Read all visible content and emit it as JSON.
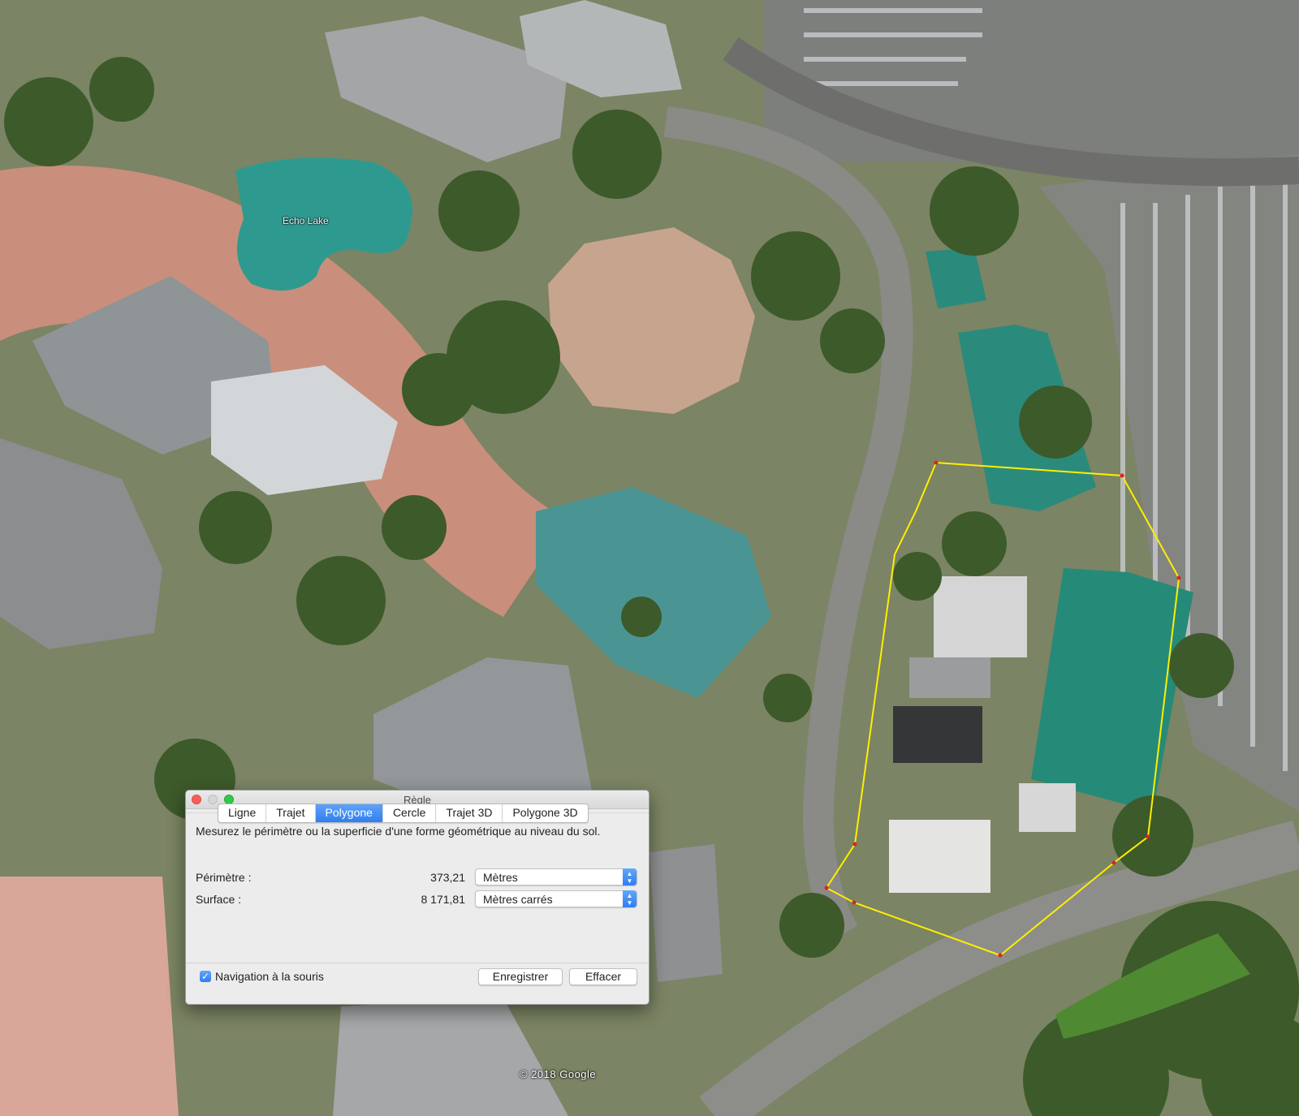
{
  "map": {
    "place_label": "Echo Lake",
    "copyright": "© 2018 Google",
    "measurement_line_color": "#ffee00",
    "vertex_color": "#e02020"
  },
  "dialog": {
    "title": "Règle",
    "tabs": [
      {
        "label": "Ligne",
        "active": false
      },
      {
        "label": "Trajet",
        "active": false
      },
      {
        "label": "Polygone",
        "active": true
      },
      {
        "label": "Cercle",
        "active": false
      },
      {
        "label": "Trajet 3D",
        "active": false
      },
      {
        "label": "Polygone 3D",
        "active": false
      }
    ],
    "description": "Mesurez le périmètre ou la superficie d'une forme géométrique au niveau du sol.",
    "perimeter": {
      "label": "Périmètre :",
      "value": "373,21",
      "unit": "Mètres"
    },
    "area": {
      "label": "Surface :",
      "value": "8 171,81",
      "unit": "Mètres carrés"
    },
    "mouse_navigation": {
      "label": "Navigation à la souris",
      "checked": true
    },
    "save_label": "Enregistrer",
    "clear_label": "Effacer",
    "accent_color": "#2f7ef2"
  }
}
